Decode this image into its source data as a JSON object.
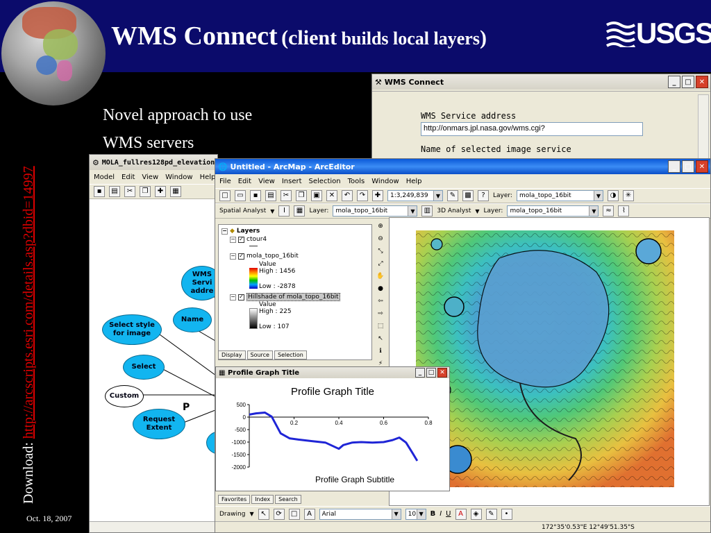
{
  "slide": {
    "title_main": "WMS Connect",
    "title_paren_open": "(",
    "title_client": "client",
    "title_rest": " builds local layers",
    "title_paren_close": ")",
    "logo_text": "USGS",
    "bullets": [
      "Novel approach to use",
      "WMS servers"
    ],
    "download_label": "Download: ",
    "download_url": "http://arcscripts.esri.com/details.asp?dbid=14997",
    "date": "Oct. 18, 2007",
    "colors": {
      "title_band": "#0b0b6b",
      "background": "#000000",
      "link": "#e00000"
    }
  },
  "wms_window": {
    "title": "WMS Connect",
    "address_label": "WMS Service address",
    "address_value": "http://onmars.jpl.nasa.gov/wms.cgi?",
    "name_label": "Name of selected image service",
    "icon": "hammer-icon"
  },
  "mola_window": {
    "title": "MOLA_fullres128pd_elevation",
    "menu": [
      "Model",
      "Edit",
      "View",
      "Window",
      "Help"
    ],
    "nodes": {
      "wms": "WMS Servi addre",
      "name": "Name",
      "select_style": "Select style for image",
      "select": "Select",
      "custom": "Custom",
      "request_extent": "Request Extent",
      "p_label": "P"
    }
  },
  "arcmap_window": {
    "title": "Untitled - ArcMap - ArcEditor",
    "menu": [
      "File",
      "Edit",
      "View",
      "Insert",
      "Selection",
      "Tools",
      "Window",
      "Help"
    ],
    "scale": "1:3,249,839",
    "layer_label": "Layer:",
    "layer_value": "mola_topo_16bit",
    "spatial_analyst": "Spatial Analyst",
    "analyst_3d": "3D Analyst",
    "toc": {
      "root": "Layers",
      "ctour": "ctour4",
      "topo": "mola_topo_16bit",
      "topo_value": "Value",
      "topo_high": "High : 1456",
      "topo_low": "Low : -2878",
      "hillshade": "Hillshade of mola_topo_16bit",
      "hill_value": "Value",
      "hill_high": "High : 225",
      "hill_low": "Low : 107"
    },
    "toc_tabs": [
      "Display",
      "Source",
      "Selection"
    ],
    "bottom_tabs": [
      "Favorites",
      "Index",
      "Search"
    ],
    "drawing_label": "Drawing",
    "font_name": "Arial",
    "font_size": "10",
    "format_buttons": [
      "B",
      "I",
      "U"
    ],
    "coords": "172°35'0.53\"E  12°49'51.35\"S"
  },
  "profile_window": {
    "title": "Profile Graph Title"
  },
  "chart_data": {
    "type": "line",
    "title": "Profile Graph Title",
    "subtitle": "Profile Graph Subtitle",
    "xlabel": "",
    "ylabel": "",
    "xlim": [
      0,
      0.8
    ],
    "ylim": [
      -2000,
      500
    ],
    "x_ticks": [
      "0.2",
      "0.4",
      "0.6",
      "0.8"
    ],
    "y_ticks": [
      "500",
      "0",
      "-500",
      "-1000",
      "-1500",
      "-2000"
    ],
    "series": [
      {
        "color": "#1f25d6",
        "x": [
          0.0,
          0.03,
          0.07,
          0.1,
          0.14,
          0.18,
          0.22,
          0.28,
          0.34,
          0.4,
          0.42,
          0.46,
          0.5,
          0.55,
          0.6,
          0.64,
          0.67,
          0.7,
          0.73,
          0.75
        ],
        "y": [
          100,
          150,
          180,
          20,
          -650,
          -850,
          -900,
          -960,
          -1020,
          -1270,
          -1120,
          -1020,
          -1000,
          -1020,
          -1000,
          -920,
          -820,
          -1020,
          -1450,
          -1750
        ]
      }
    ],
    "grid": false
  }
}
